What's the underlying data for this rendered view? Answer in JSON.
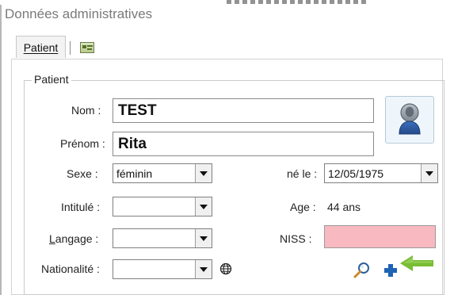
{
  "window": {
    "title": "Données administratives"
  },
  "tabs": [
    {
      "label": "Patient"
    }
  ],
  "group": {
    "caption": "Patient"
  },
  "fields": {
    "nom": {
      "label": "Nom :",
      "value": "TEST"
    },
    "prenom": {
      "label": "Prénom :",
      "value": "Rita"
    },
    "sexe": {
      "label": "Sexe :",
      "value": "féminin"
    },
    "intitule": {
      "label": "Intitulé :",
      "value": ""
    },
    "langage": {
      "label": "Langage :",
      "value": ""
    },
    "nationalite": {
      "label": "Nationalité :",
      "value": ""
    },
    "ne_le": {
      "label": "né le :",
      "value": "12/05/1975"
    },
    "age": {
      "label": "Age :",
      "value": "44 ans"
    },
    "niss": {
      "label": "NISS :",
      "value": ""
    }
  },
  "colors": {
    "niss_background": "#f8b9c0",
    "avatar_blue": "#244a87",
    "add_blue": "#1f63b5",
    "arrow_green": "#79bd35"
  },
  "icons": {
    "patient_tab": "id-card-icon",
    "avatar": "user-avatar-icon",
    "nationality": "globe-icon",
    "search": "search-icon",
    "add": "plus-icon",
    "pointer": "green-arrow-icon"
  }
}
